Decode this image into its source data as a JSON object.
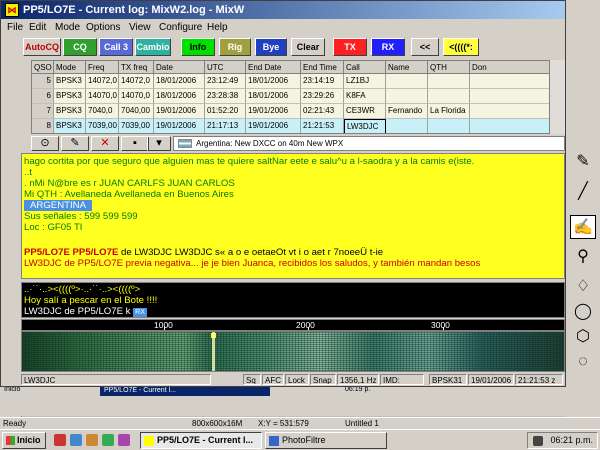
{
  "window": {
    "title": "PP5/LO7E - Current log: MixW2.log - MixW",
    "icon": "mixw-app-icon"
  },
  "menu": [
    "File",
    "Edit",
    "Mode",
    "Options",
    "View",
    "Configure",
    "Help"
  ],
  "toolbar": {
    "buttons": [
      {
        "label": "AutoCQ",
        "bg": "#d4d0c8",
        "fg": "#c00000"
      },
      {
        "label": "CQ",
        "bg": "#30a030",
        "fg": "#ffffff"
      },
      {
        "label": "Call 3",
        "bg": "#5a6ad4",
        "fg": "#ffffff"
      },
      {
        "label": "Cambio",
        "bg": "#30b0a0",
        "fg": "#ffffff"
      },
      {
        "label": "Info",
        "bg": "#00e000",
        "fg": "#000000"
      },
      {
        "label": "Rig",
        "bg": "#a0a040",
        "fg": "#ffffff"
      },
      {
        "label": "Bye",
        "bg": "#2040c0",
        "fg": "#ffffff"
      },
      {
        "label": "Clear",
        "bg": "#d4d0c8",
        "fg": "#000000"
      },
      {
        "label": "TX",
        "bg": "#ff2020",
        "fg": "#ffffff"
      },
      {
        "label": "RX",
        "bg": "#2020ff",
        "fg": "#ffffff"
      },
      {
        "label": "<<",
        "bg": "#d4d0c8",
        "fg": "#000000"
      },
      {
        "label": "<((((*:",
        "bg": "#ffff40",
        "fg": "#000000"
      }
    ]
  },
  "qso_table": {
    "columns": [
      "QSO",
      "Mode",
      "Freq",
      "TX freq",
      "Date",
      "UTC",
      "End Date",
      "End Time",
      "Call",
      "Name",
      "QTH",
      "Don"
    ],
    "rows": [
      [
        "5",
        "BPSK3",
        "14072,0",
        "14072,0",
        "18/01/2006",
        "23:12:49",
        "18/01/2006",
        "23:14:19",
        "LZ1BJ",
        "",
        "",
        ""
      ],
      [
        "6",
        "BPSK3",
        "14070,0",
        "14070,0",
        "18/01/2006",
        "23:28:38",
        "18/01/2006",
        "23:29:26",
        "K8FA",
        "",
        "",
        ""
      ],
      [
        "7",
        "BPSK3",
        "7040,0",
        "7040,00",
        "19/01/2006",
        "01:52:20",
        "19/01/2006",
        "02:21:43",
        "CE3WR",
        "Fernando",
        "La Florida",
        ""
      ],
      [
        "8",
        "BPSK3",
        "7039,00",
        "7039,00",
        "19/01/2006",
        "21:17:13",
        "19/01/2006",
        "21:21:53",
        "LW3DJC",
        "",
        "",
        ""
      ]
    ],
    "selected_row": 3
  },
  "toolbar2": {
    "dxcc_text": "Argentina:  New DXCC on 40m New WPX"
  },
  "rx_text": {
    "lines": [
      {
        "text": "hago cortita por que seguro que alguien mas te quiere saltNar eete e salu^u a l-saodra y a la camis  e(iste.",
        "color": "green"
      },
      {
        "text": "..t",
        "color": "green"
      },
      {
        "text": " . nMi N@bre es  r JUAN CARLFS JUAN CARLOS",
        "color": "green"
      },
      {
        "text": "Mi QTH : Avellaneda   Avellaneda   en Buenos Aires",
        "color": "green"
      },
      {
        "text": "ARGENTINA",
        "color": "green",
        "highlight": true
      },
      {
        "text": "Sus señales : 599 599 599",
        "color": "green"
      },
      {
        "text": "Loc : GF05 TI",
        "color": "green"
      },
      {
        "text": "",
        "color": "green"
      },
      {
        "text": "PP5/LO7E PP5/LO7E de  LW3DJC LW3DJC s« a  o e oetaeOt vt i o aet r   7noeeÜ t-ie",
        "color": "mixed"
      },
      {
        "text": "LW3DJC de PP5/LO7E previa negativa... je je  bien Juanca, recibidos los saludos, y también mandan besos",
        "color": "red"
      }
    ],
    "line9_part1": "PP5/LO7E PP5/LO7E",
    "line9_part2": " de  LW3DJC LW3DJC s« a  o e oetaeOt vt i o aet r   7noeeÜ t-ie"
  },
  "tx_text": {
    "line1": "  ..·˙˙·..><((((º>·..·˙˙·..><((((º>",
    "line2": "Hoy salí a pescar en el Bote !!!!",
    "line3": "LW3DJC de PP5/LO7E k",
    "badge": "RX"
  },
  "waterfall": {
    "scale_labels": [
      "1000",
      "2000",
      "3000"
    ]
  },
  "mix_status": {
    "call": "LW3DJC",
    "sq": "Sq",
    "afc": "AFC",
    "lock": "Lock",
    "snap": "Snap",
    "freq": "1356,1 Hz",
    "imd": "IMD:",
    "mode": "BPSK31",
    "date": "19/01/2006",
    "time": "21:21:53 z"
  },
  "bg_app": {
    "mini_window_title": "PP5/LO7E - Current l...",
    "mini_start": "Inicio",
    "mini_clock": "06:19 p.",
    "status_ready": "Ready",
    "status_size": "800x600x16M",
    "status_xy": "X:Y = 531:579",
    "status_file": "Untitled 1"
  },
  "taskbar": {
    "start_label": "Inicio",
    "tasks": [
      {
        "label": "PP5/LO7E - Current l...",
        "active": true
      },
      {
        "label": "PhotoFiltre",
        "active": false
      }
    ],
    "clock": "06:21 p.m."
  },
  "colors": {
    "rx_bg": "#ffff20",
    "tx_bg": "#000000",
    "title_start": "#0a246a",
    "title_end": "#a6caf0"
  }
}
